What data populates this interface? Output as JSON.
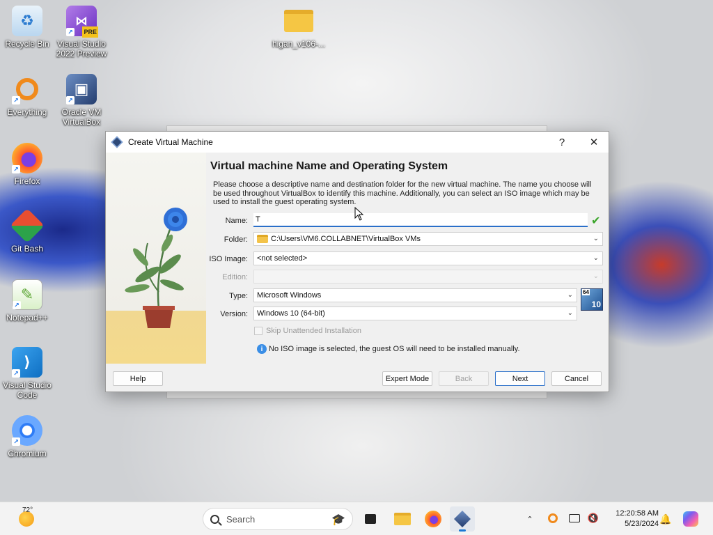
{
  "desktop": {
    "icons": [
      {
        "label": "Recycle Bin"
      },
      {
        "label": "Visual Studio 2022 Preview",
        "badge": "PRE"
      },
      {
        "label": "higan_v106-..."
      },
      {
        "label": "Everything"
      },
      {
        "label": "Oracle VM VirtualBox"
      },
      {
        "label": "Firefox"
      },
      {
        "label": "Git Bash"
      },
      {
        "label": "Notepad++"
      },
      {
        "label": "Visual Studio Code"
      },
      {
        "label": "Chromium"
      }
    ]
  },
  "dialog": {
    "title": "Create Virtual Machine",
    "help_glyph": "?",
    "close_glyph": "✕",
    "heading": "Virtual machine Name and Operating System",
    "description": "Please choose a descriptive name and destination folder for the new virtual machine. The name you choose will be used throughout VirtualBox to identify this machine. Additionally, you can select an ISO image which may be used to install the guest operating system.",
    "fields": {
      "name": {
        "label": "Name:",
        "value": "T"
      },
      "folder": {
        "label": "Folder:",
        "value": "C:\\Users\\VM6.COLLABNET\\VirtualBox VMs"
      },
      "iso": {
        "label": "ISO Image:",
        "value": "<not selected>"
      },
      "edition": {
        "label": "Edition:",
        "value": ""
      },
      "type": {
        "label": "Type:",
        "value": "Microsoft Windows"
      },
      "version": {
        "label": "Version:",
        "value": "Windows 10 (64-bit)"
      }
    },
    "os_badge": {
      "top": "64",
      "bottom": "10"
    },
    "skip_unattended": {
      "label": "Skip Unattended Installation",
      "checked": false
    },
    "info_text": "No ISO image is selected, the guest OS will need to be installed manually.",
    "buttons": {
      "help": "Help",
      "expert": "Expert Mode",
      "back": "Back",
      "next": "Next",
      "cancel": "Cancel"
    }
  },
  "taskbar": {
    "weather_temp": "72°",
    "search_placeholder": "Search",
    "clock_time": "12:20:58 AM",
    "clock_date": "5/23/2024"
  },
  "colors": {
    "accent": "#2a6fc9",
    "check": "#3aa52a"
  }
}
